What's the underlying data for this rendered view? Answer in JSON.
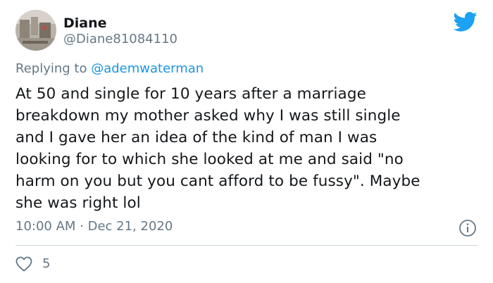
{
  "tweet": {
    "author": {
      "name": "Diane",
      "handle": "@Diane81084110"
    },
    "reply_prefix": "Replying to ",
    "reply_to": "@ademwaterman",
    "text": "At 50 and single for 10 years after a marriage\nbreakdown my mother asked why I was still single\nand I gave her an idea of the kind of man I was\nlooking for to which she looked at me and said  \"no\nharm on you but you cant afford to be fussy\". Maybe\nshe was right lol",
    "timestamp": "10:00 AM · Dec 21, 2020",
    "likes": "5"
  },
  "icons": {
    "brand": "twitter-bird-icon",
    "info": "info-icon",
    "like": "heart-icon"
  },
  "colors": {
    "twitter_blue": "#1da1f2",
    "mention_blue": "#1b95e0",
    "secondary_text": "#657786",
    "divider": "#cfd9de"
  }
}
